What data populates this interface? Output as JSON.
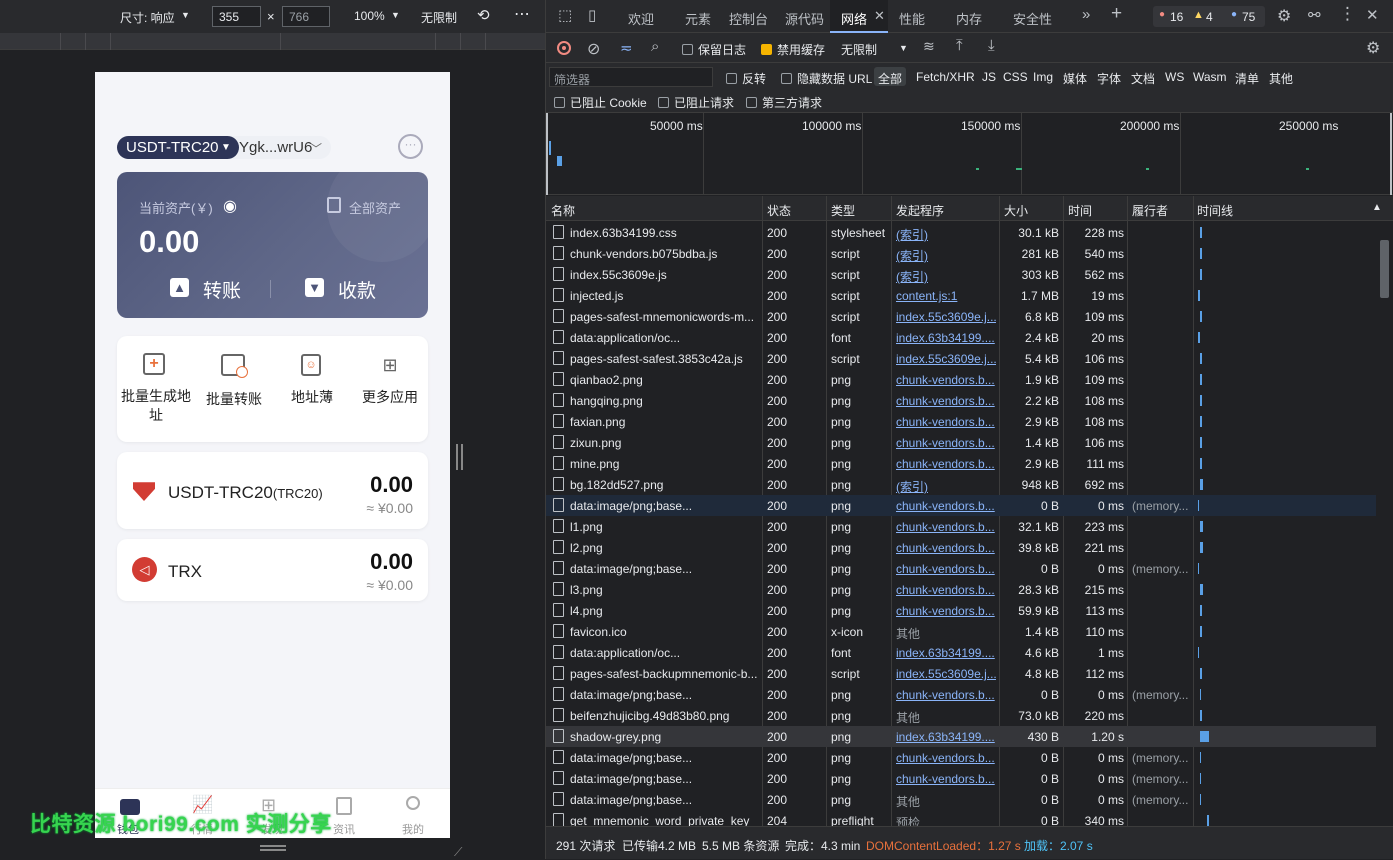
{
  "device_toolbar": {
    "size_label": "尺寸: 响应",
    "width": "355",
    "height": "766",
    "times": "×",
    "zoom": "100%",
    "throttle": "无限制"
  },
  "app": {
    "token_selector": "USDT-TRC20",
    "address": "Ygk...wrU6",
    "asset_label": "当前资产(￥)",
    "all_assets": "全部资产",
    "balance": "0.00",
    "transfer": "转账",
    "receive": "收款",
    "quick_actions": [
      "批量生成地址",
      "批量转账",
      "地址薄",
      "更多应用"
    ],
    "tokens": [
      {
        "name": "USDT-TRC20",
        "sub": "(TRC20)",
        "amount": "0.00",
        "fiat": "≈ ¥0.00"
      },
      {
        "name": "TRX",
        "sub": "",
        "amount": "0.00",
        "fiat": "≈ ¥0.00"
      }
    ],
    "bottom_nav": [
      "钱包",
      "行情",
      "发现",
      "资讯",
      "我的"
    ]
  },
  "watermark": "比特资源 bori99.com 实测分享",
  "devtools": {
    "tabs": [
      "欢迎",
      "元素",
      "控制台",
      "源代码",
      "网络",
      "性能",
      "内存",
      "安全性"
    ],
    "active_tab": "网络",
    "errors": "16",
    "warnings": "4",
    "messages": "75",
    "toolbar": {
      "preserve_log": "保留日志",
      "disable_cache": "禁用缓存",
      "throttle": "无限制"
    },
    "filter": {
      "placeholder": "筛选器",
      "invert": "反转",
      "hide_data_urls": "隐藏数据 URL",
      "types": [
        "全部",
        "Fetch/XHR",
        "JS",
        "CSS",
        "Img",
        "媒体",
        "字体",
        "文档",
        "WS",
        "Wasm",
        "清单",
        "其他"
      ],
      "blocked_cookies": "已阻止 Cookie",
      "blocked_requests": "已阻止请求",
      "third_party": "第三方请求"
    },
    "timeline_ticks": [
      "50000 ms",
      "100000 ms",
      "150000 ms",
      "200000 ms",
      "250000 ms"
    ],
    "columns": [
      "名称",
      "状态",
      "类型",
      "发起程序",
      "大小",
      "时间",
      "履行者",
      "时间线"
    ],
    "requests": [
      {
        "name": "index.63b34199.css",
        "status": "200",
        "type": "stylesheet",
        "initiator": "(索引)",
        "size": "30.1 kB",
        "time": "228 ms",
        "fulfilled": ""
      },
      {
        "name": "chunk-vendors.b075bdba.js",
        "status": "200",
        "type": "script",
        "initiator": "(索引)",
        "size": "281 kB",
        "time": "540 ms",
        "fulfilled": ""
      },
      {
        "name": "index.55c3609e.js",
        "status": "200",
        "type": "script",
        "initiator": "(索引)",
        "size": "303 kB",
        "time": "562 ms",
        "fulfilled": ""
      },
      {
        "name": "injected.js",
        "status": "200",
        "type": "script",
        "initiator": "content.js:1",
        "size": "1.7 MB",
        "time": "19 ms",
        "fulfilled": ""
      },
      {
        "name": "pages-safest-mnemonicwords-m...",
        "status": "200",
        "type": "script",
        "initiator": "index.55c3609e.j...",
        "size": "6.8 kB",
        "time": "109 ms",
        "fulfilled": ""
      },
      {
        "name": "data:application/oc...",
        "status": "200",
        "type": "font",
        "initiator": "index.63b34199....",
        "size": "2.4 kB",
        "time": "20 ms",
        "fulfilled": ""
      },
      {
        "name": "pages-safest-safest.3853c42a.js",
        "status": "200",
        "type": "script",
        "initiator": "index.55c3609e.j...",
        "size": "5.4 kB",
        "time": "106 ms",
        "fulfilled": ""
      },
      {
        "name": "qianbao2.png",
        "status": "200",
        "type": "png",
        "initiator": "chunk-vendors.b...",
        "size": "1.9 kB",
        "time": "109 ms",
        "fulfilled": ""
      },
      {
        "name": "hangqing.png",
        "status": "200",
        "type": "png",
        "initiator": "chunk-vendors.b...",
        "size": "2.2 kB",
        "time": "108 ms",
        "fulfilled": ""
      },
      {
        "name": "faxian.png",
        "status": "200",
        "type": "png",
        "initiator": "chunk-vendors.b...",
        "size": "2.9 kB",
        "time": "108 ms",
        "fulfilled": ""
      },
      {
        "name": "zixun.png",
        "status": "200",
        "type": "png",
        "initiator": "chunk-vendors.b...",
        "size": "1.4 kB",
        "time": "106 ms",
        "fulfilled": ""
      },
      {
        "name": "mine.png",
        "status": "200",
        "type": "png",
        "initiator": "chunk-vendors.b...",
        "size": "2.9 kB",
        "time": "111 ms",
        "fulfilled": ""
      },
      {
        "name": "bg.182dd527.png",
        "status": "200",
        "type": "png",
        "initiator": "(索引)",
        "size": "948 kB",
        "time": "692 ms",
        "fulfilled": ""
      },
      {
        "name": "data:image/png;base...",
        "status": "200",
        "type": "png",
        "initiator": "chunk-vendors.b...",
        "size": "0 B",
        "time": "0 ms",
        "fulfilled": "(memory..."
      },
      {
        "name": "l1.png",
        "status": "200",
        "type": "png",
        "initiator": "chunk-vendors.b...",
        "size": "32.1 kB",
        "time": "223 ms",
        "fulfilled": ""
      },
      {
        "name": "l2.png",
        "status": "200",
        "type": "png",
        "initiator": "chunk-vendors.b...",
        "size": "39.8 kB",
        "time": "221 ms",
        "fulfilled": ""
      },
      {
        "name": "data:image/png;base...",
        "status": "200",
        "type": "png",
        "initiator": "chunk-vendors.b...",
        "size": "0 B",
        "time": "0 ms",
        "fulfilled": "(memory..."
      },
      {
        "name": "l3.png",
        "status": "200",
        "type": "png",
        "initiator": "chunk-vendors.b...",
        "size": "28.3 kB",
        "time": "215 ms",
        "fulfilled": ""
      },
      {
        "name": "l4.png",
        "status": "200",
        "type": "png",
        "initiator": "chunk-vendors.b...",
        "size": "59.9 kB",
        "time": "113 ms",
        "fulfilled": ""
      },
      {
        "name": "favicon.ico",
        "status": "200",
        "type": "x-icon",
        "initiator": "其他",
        "size": "1.4 kB",
        "time": "110 ms",
        "fulfilled": ""
      },
      {
        "name": "data:application/oc...",
        "status": "200",
        "type": "font",
        "initiator": "index.63b34199....",
        "size": "4.6 kB",
        "time": "1 ms",
        "fulfilled": ""
      },
      {
        "name": "pages-safest-backupmnemonic-b...",
        "status": "200",
        "type": "script",
        "initiator": "index.55c3609e.j...",
        "size": "4.8 kB",
        "time": "112 ms",
        "fulfilled": ""
      },
      {
        "name": "data:image/png;base...",
        "status": "200",
        "type": "png",
        "initiator": "chunk-vendors.b...",
        "size": "0 B",
        "time": "0 ms",
        "fulfilled": "(memory..."
      },
      {
        "name": "beifenzhujicibg.49d83b80.png",
        "status": "200",
        "type": "png",
        "initiator": "其他",
        "size": "73.0 kB",
        "time": "220 ms",
        "fulfilled": ""
      },
      {
        "name": "shadow-grey.png",
        "status": "200",
        "type": "png",
        "initiator": "index.63b34199....",
        "size": "430 B",
        "time": "1.20 s",
        "fulfilled": ""
      },
      {
        "name": "data:image/png;base...",
        "status": "200",
        "type": "png",
        "initiator": "chunk-vendors.b...",
        "size": "0 B",
        "time": "0 ms",
        "fulfilled": "(memory..."
      },
      {
        "name": "data:image/png;base...",
        "status": "200",
        "type": "png",
        "initiator": "chunk-vendors.b...",
        "size": "0 B",
        "time": "0 ms",
        "fulfilled": "(memory..."
      },
      {
        "name": "data:image/png;base...",
        "status": "200",
        "type": "png",
        "initiator": "其他",
        "size": "0 B",
        "time": "0 ms",
        "fulfilled": "(memory..."
      },
      {
        "name": "get_mnemonic_word_private_key",
        "status": "204",
        "type": "preflight",
        "initiator": "预检",
        "size": "0 B",
        "time": "340 ms",
        "fulfilled": ""
      }
    ],
    "status_bar": {
      "requests": "291 次请求",
      "transferred": "已传输4.2 MB",
      "resources": "5.5 MB 条资源",
      "finish": "完成：4.3 min",
      "dcl": "DOMContentLoaded：1.27 s",
      "load": "加载：2.07 s"
    }
  }
}
